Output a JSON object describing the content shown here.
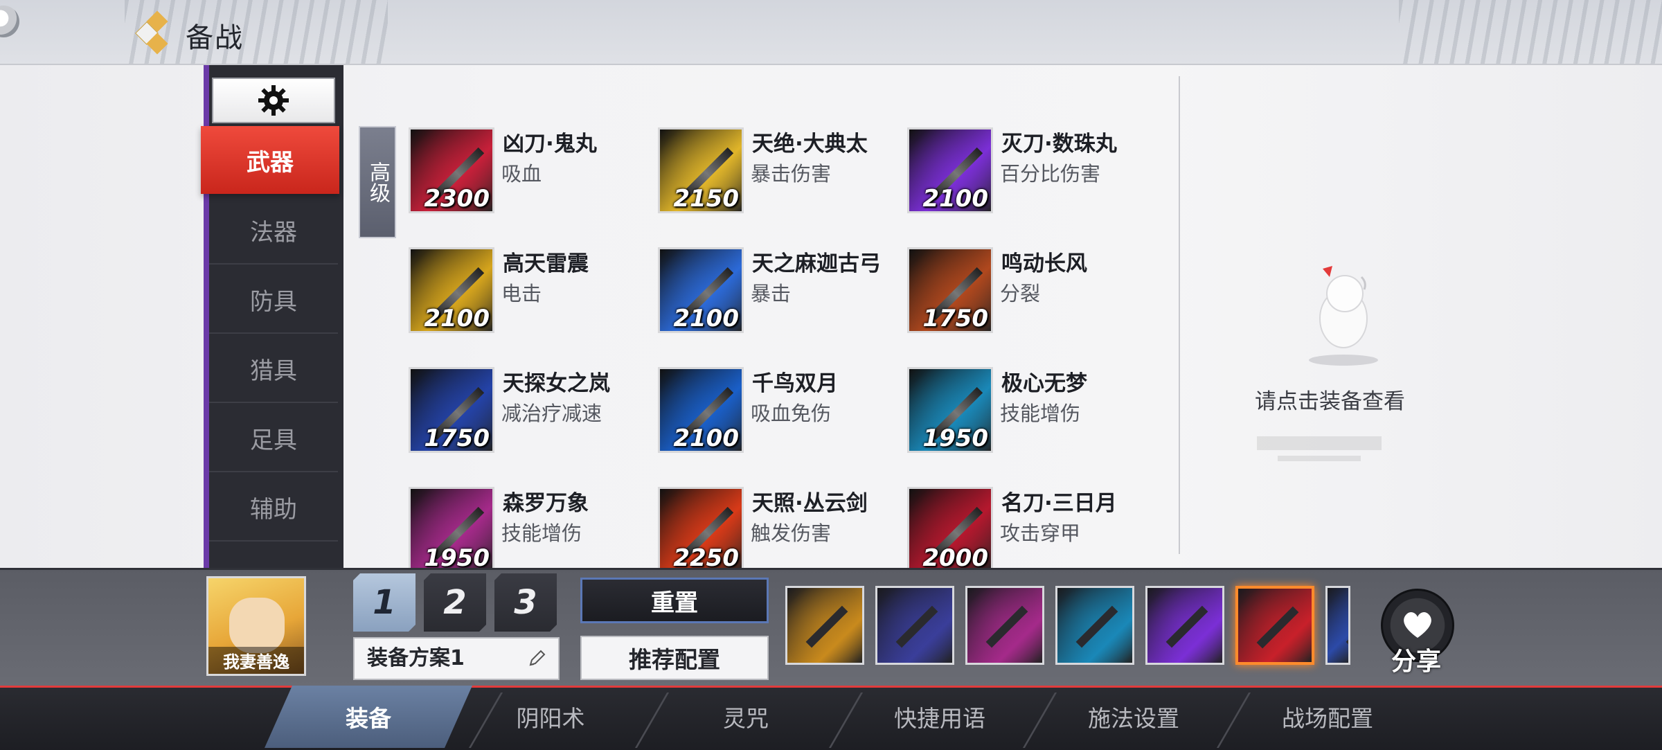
{
  "header": {
    "title": "备战"
  },
  "sidebar": {
    "settings_icon": "gear-icon",
    "categories": [
      {
        "label": "武器",
        "active": true
      },
      {
        "label": "法器"
      },
      {
        "label": "防具"
      },
      {
        "label": "猎具"
      },
      {
        "label": "足具"
      },
      {
        "label": "辅助"
      }
    ]
  },
  "tier_tag": "高级",
  "items": [
    {
      "name": "凶刀·鬼丸",
      "desc": "吸血",
      "price": "2300",
      "color": "#c8203a"
    },
    {
      "name": "天绝·大典太",
      "desc": "暴击伤害",
      "price": "2150",
      "color": "#e0b52a"
    },
    {
      "name": "灭刀·数珠丸",
      "desc": "百分比伤害",
      "price": "2100",
      "color": "#7b2fd6"
    },
    {
      "name": "高天雷震",
      "desc": "电击",
      "price": "2100",
      "color": "#d6a51d"
    },
    {
      "name": "天之麻迦古弓",
      "desc": "暴击",
      "price": "2100",
      "color": "#2c6ad8"
    },
    {
      "name": "鸣动长风",
      "desc": "分裂",
      "price": "1750",
      "color": "#b0481e"
    },
    {
      "name": "天探女之岚",
      "desc": "减治疗减速",
      "price": "1750",
      "color": "#2443a8"
    },
    {
      "name": "千鸟双月",
      "desc": "吸血免伤",
      "price": "2100",
      "color": "#1a5fc8"
    },
    {
      "name": "极心无梦",
      "desc": "技能增伤",
      "price": "1950",
      "color": "#1a88b8"
    },
    {
      "name": "森罗万象",
      "desc": "技能增伤",
      "price": "1950",
      "color": "#a52a8a"
    },
    {
      "name": "天照·丛云剑",
      "desc": "触发伤害",
      "price": "2250",
      "color": "#d83a18"
    },
    {
      "name": "名刀·三日月",
      "desc": "攻击穿甲",
      "price": "2000",
      "color": "#b5182e"
    }
  ],
  "detail_panel": {
    "empty_text": "请点击装备查看"
  },
  "equip_bar": {
    "hero_name": "我妻善逸",
    "plan_tabs": [
      "1",
      "2",
      "3"
    ],
    "active_plan": "1",
    "plan_name": "装备方案1",
    "reset_label": "重置",
    "recommend_label": "推荐配置",
    "share_label": "分享",
    "slots": [
      {
        "icon": "spear-icon",
        "color": "#c98a1d"
      },
      {
        "icon": "boot-icon",
        "color": "#3a3e9a"
      },
      {
        "icon": "axe-icon",
        "color": "#a52a8a"
      },
      {
        "icon": "chain-blade-icon",
        "color": "#1a88b8"
      },
      {
        "icon": "katana-icon",
        "color": "#7b2fd6"
      },
      {
        "icon": "hammer-icon",
        "color": "#c8202a",
        "selected": true
      },
      {
        "icon": "partial-icon",
        "color": "#2c4aa8"
      }
    ]
  },
  "bottom_tabs": [
    {
      "label": "装备",
      "active": true
    },
    {
      "label": "阴阳术"
    },
    {
      "label": "灵咒"
    },
    {
      "label": "快捷用语"
    },
    {
      "label": "施法设置"
    },
    {
      "label": "战场配置"
    }
  ]
}
